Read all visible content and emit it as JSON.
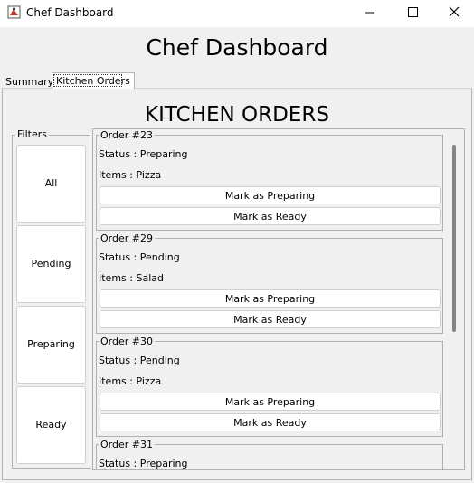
{
  "window": {
    "title": "Chef Dashboard",
    "buttons": {
      "minimize": "minimize-icon",
      "maximize": "maximize-icon",
      "close": "close-icon"
    }
  },
  "header": {
    "title": "Chef Dashboard"
  },
  "tabs": [
    {
      "label": "Summary",
      "selected": false
    },
    {
      "label": "Kitchen Orders",
      "selected": true
    }
  ],
  "kitchen": {
    "title": "KITCHEN ORDERS",
    "filters": {
      "legend": "Filters",
      "items": [
        "All",
        "Pending",
        "Preparing",
        "Ready"
      ]
    },
    "orders": [
      {
        "legend": "Order #23",
        "status": "Status : Preparing",
        "items": "Items : Pizza",
        "prep_label": "Mark as Preparing",
        "ready_label": "Mark as Ready"
      },
      {
        "legend": "Order #29",
        "status": "Status : Pending",
        "items": "Items : Salad",
        "prep_label": "Mark as Preparing",
        "ready_label": "Mark as Ready"
      },
      {
        "legend": "Order #30",
        "status": "Status : Pending",
        "items": "Items : Pizza",
        "prep_label": "Mark as Preparing",
        "ready_label": "Mark as Ready"
      },
      {
        "legend": "Order #31",
        "status": "Status : Preparing"
      }
    ]
  },
  "colors": {
    "window_bg": "#f0f0f0",
    "titlebar_bg": "#ffffff",
    "button_bg": "#ffffff",
    "border": "#b0b0b0",
    "scroll_thumb": "#858585"
  }
}
